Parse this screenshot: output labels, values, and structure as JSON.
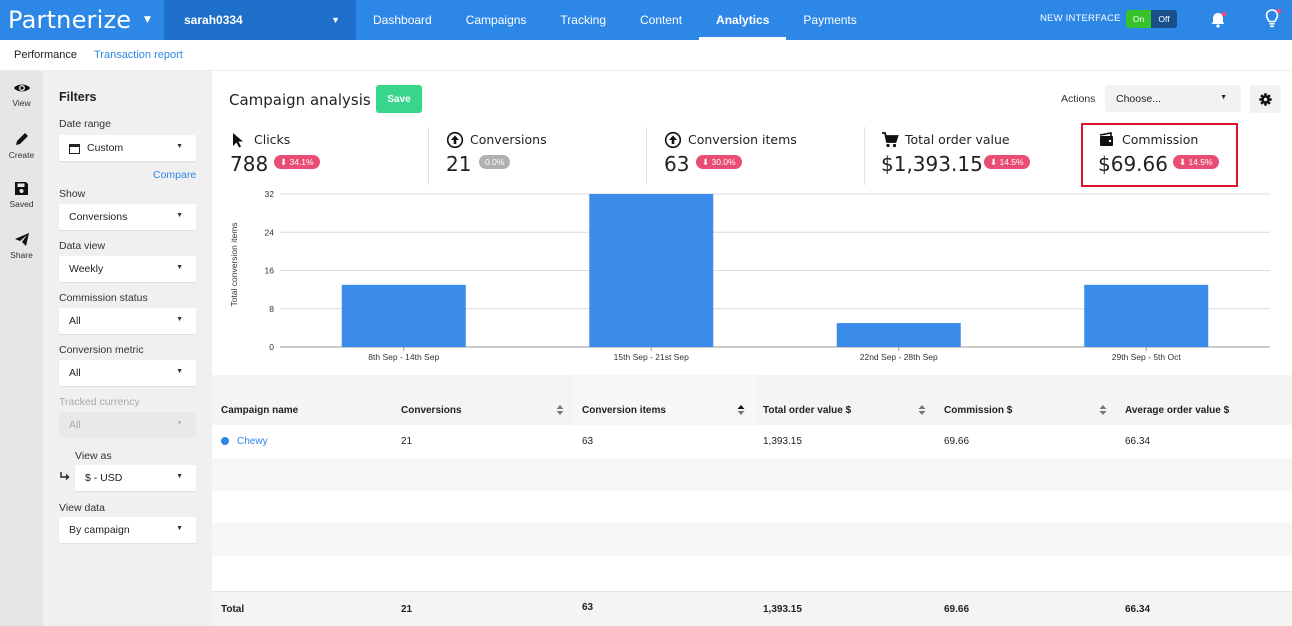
{
  "topnav": {
    "logo": "Partnerize",
    "account": "sarah0334",
    "items": [
      "Dashboard",
      "Campaigns",
      "Tracking",
      "Content",
      "Analytics",
      "Payments"
    ],
    "active_index": 4,
    "new_interface_label": "NEW INTERFACE",
    "toggle_on": "On",
    "toggle_off": "Off"
  },
  "subnav": {
    "performance": "Performance",
    "transaction_report": "Transaction report"
  },
  "rail": {
    "items": [
      {
        "label": "View",
        "icon": "eye-icon"
      },
      {
        "label": "Create",
        "icon": "pencil-icon"
      },
      {
        "label": "Saved",
        "icon": "floppy-disk-icon"
      },
      {
        "label": "Share",
        "icon": "paper-plane-icon"
      }
    ]
  },
  "filters": {
    "title": "Filters",
    "date_range_label": "Date range",
    "date_range_value": "Custom",
    "compare_label": "Compare",
    "show_label": "Show",
    "show_value": "Conversions",
    "data_view_label": "Data view",
    "data_view_value": "Weekly",
    "commission_status_label": "Commission status",
    "commission_status_value": "All",
    "conversion_metric_label": "Conversion metric",
    "conversion_metric_value": "All",
    "tracked_currency_label": "Tracked currency",
    "tracked_currency_value": "All",
    "view_as_label": "View as",
    "view_as_value": "$ - USD",
    "view_data_label": "View data",
    "view_data_value": "By campaign"
  },
  "main": {
    "title": "Campaign analysis",
    "save_label": "Save",
    "actions_label": "Actions",
    "actions_placeholder": "Choose..."
  },
  "metrics": [
    {
      "label": "Clicks",
      "value": "788",
      "change": "34.1%",
      "trend": "down"
    },
    {
      "label": "Conversions",
      "value": "21",
      "change": "0.0%",
      "trend": "neutral"
    },
    {
      "label": "Conversion items",
      "value": "63",
      "change": "30.0%",
      "trend": "down"
    },
    {
      "label": "Total order value",
      "value": "$1,393.15",
      "change": "14.5%",
      "trend": "down"
    },
    {
      "label": "Commission",
      "value": "$69.66",
      "change": "14.5%",
      "trend": "down"
    }
  ],
  "colors": {
    "brand": "#2d87e6",
    "bar": "#3b8beb",
    "negative": "#e94d73",
    "save": "#38d68a",
    "highlight": "#d7162a"
  },
  "chart_data": {
    "type": "bar",
    "ylabel": "Total conversion items",
    "categories": [
      "8th Sep - 14th Sep",
      "15th Sep - 21st Sep",
      "22nd Sep - 28th Sep",
      "29th Sep - 5th Oct"
    ],
    "values": [
      13,
      32,
      5,
      13
    ],
    "ylim": [
      0,
      32
    ],
    "yticks": [
      "0",
      "8",
      "16",
      "24",
      "32"
    ],
    "grid": true
  },
  "table": {
    "columns": [
      "Campaign name",
      "Conversions",
      "Conversion items",
      "Total order value $",
      "Commission $",
      "Average order value $"
    ],
    "rows": [
      {
        "campaign": "Chewy",
        "conversions": "21",
        "items": "63",
        "order_value": "1,393.15",
        "commission": "69.66",
        "avg_order_value": "66.34"
      }
    ],
    "total": {
      "label": "Total",
      "conversions": "21",
      "items": "63",
      "order_value": "1,393.15",
      "commission": "69.66",
      "avg_order_value": "66.34"
    }
  }
}
